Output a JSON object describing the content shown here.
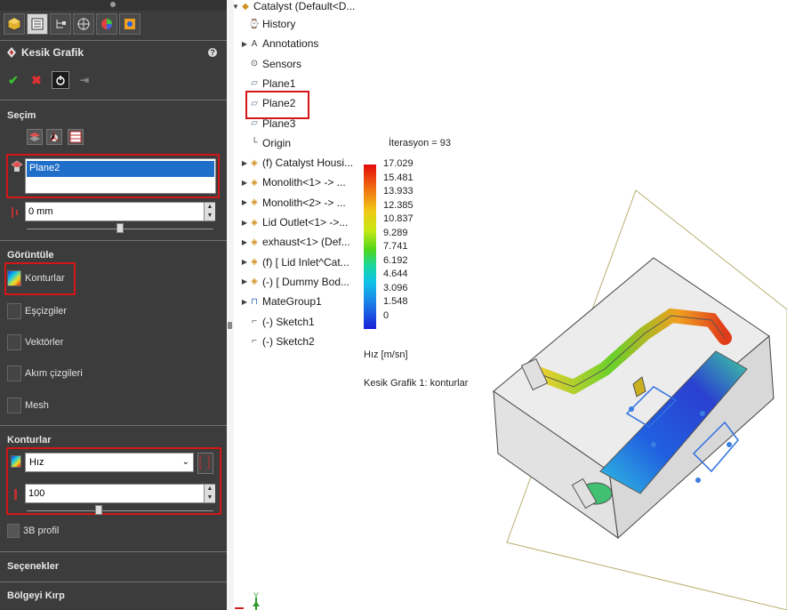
{
  "panel": {
    "title": "Kesik Grafik",
    "sections": {
      "secim": "Seçim",
      "goruntule": "Görüntüle",
      "konturlar": "Konturlar",
      "secenekler": "Seçenekler",
      "bolge": "Bölgeyi Kırp"
    },
    "selection_value": "Plane2",
    "offset_value": "0 mm",
    "display_items": [
      "Konturlar",
      "Eşçizgiler",
      "Vektörler",
      "Akım çizgileri",
      "Mesh"
    ],
    "parameter": "Hız",
    "levels_value": "100",
    "profile_label": "3B profil"
  },
  "tree": {
    "root": "Catalyst  (Default<D...",
    "items": [
      {
        "label": "History",
        "icon": "history-icon",
        "arrow": false
      },
      {
        "label": "Annotations",
        "icon": "annotations-icon",
        "arrow": true
      },
      {
        "label": "Sensors",
        "icon": "sensors-icon",
        "arrow": false
      },
      {
        "label": "Plane1",
        "icon": "plane-icon",
        "arrow": false
      },
      {
        "label": "Plane2",
        "icon": "plane-icon",
        "arrow": false
      },
      {
        "label": "Plane3",
        "icon": "plane-icon",
        "arrow": false
      },
      {
        "label": "Origin",
        "icon": "origin-icon",
        "arrow": false
      },
      {
        "label": "(f) Catalyst Housi...",
        "icon": "part-icon",
        "arrow": true
      },
      {
        "label": "Monolith<1> -> ...",
        "icon": "part-icon",
        "arrow": true
      },
      {
        "label": "Monolith<2> -> ...",
        "icon": "part-icon",
        "arrow": true
      },
      {
        "label": "Lid Outlet<1> ->...",
        "icon": "part-icon",
        "arrow": true
      },
      {
        "label": "exhaust<1> (Def...",
        "icon": "part-icon",
        "arrow": true
      },
      {
        "label": "(f) [ Lid Inlet^Cat...",
        "icon": "part-icon",
        "arrow": true
      },
      {
        "label": "(-) [ Dummy Bod...",
        "icon": "part-icon",
        "arrow": true
      },
      {
        "label": "MateGroup1",
        "icon": "mategroup-icon",
        "arrow": true
      },
      {
        "label": "(-) Sketch1",
        "icon": "sketch-icon",
        "arrow": false
      },
      {
        "label": "(-) Sketch2",
        "icon": "sketch-icon",
        "arrow": false
      }
    ]
  },
  "legend": {
    "iteration": "İterasyon = 93",
    "values": [
      "17.029",
      "15.481",
      "13.933",
      "12.385",
      "10.837",
      "9.289",
      "7.741",
      "6.192",
      "4.644",
      "3.096",
      "1.548",
      "0"
    ],
    "unit": "Hız [m/sn]",
    "plot_name": "Kesik Grafik 1: konturlar"
  },
  "triad": {
    "y_label": "Y"
  },
  "colors": {
    "highlight": "#d41616",
    "panel_bg": "#3c3c3c",
    "selection": "#1f6fc9"
  }
}
